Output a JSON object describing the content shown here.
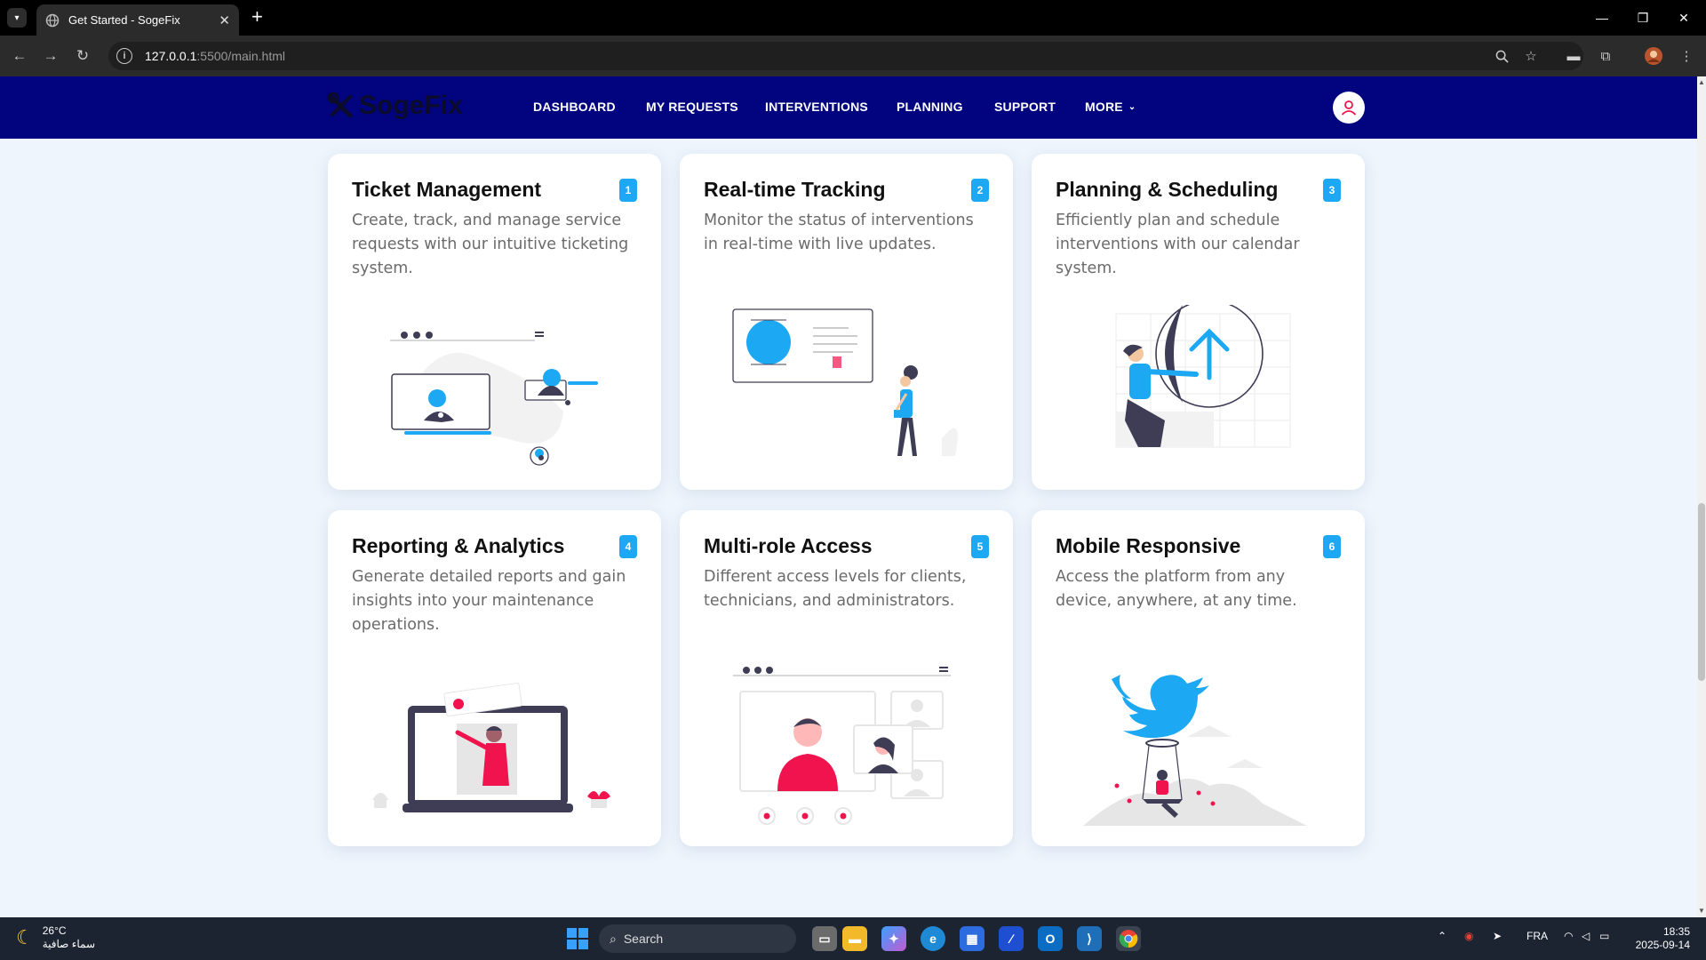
{
  "browser": {
    "tab_title": "Get Started - SogeFix",
    "url_host": "127.0.0.1",
    "url_rest": ":5500/main.html"
  },
  "app": {
    "logo_text": "SogeFix",
    "nav": [
      "DASHBOARD",
      "MY REQUESTS",
      "INTERVENTIONS",
      "PLANNING",
      "SUPPORT",
      "MORE"
    ],
    "accent": "#1ca8f3",
    "nav_bg": "#02037e",
    "pink": "#f0134d"
  },
  "features": [
    {
      "num": "1",
      "title": "Ticket Management",
      "desc": "Create, track, and manage service requests with our intuitive ticketing system.",
      "icon": "ticket-illustration"
    },
    {
      "num": "2",
      "title": "Real-time Tracking",
      "desc": "Monitor the status of interventions in real-time with live updates.",
      "icon": "tracking-illustration"
    },
    {
      "num": "3",
      "title": "Planning & Scheduling",
      "desc": "Efficiently plan and schedule interventions with our calendar system.",
      "icon": "planning-illustration"
    },
    {
      "num": "4",
      "title": "Reporting & Analytics",
      "desc": "Generate detailed reports and gain insights into your maintenance operations.",
      "icon": "reporting-illustration"
    },
    {
      "num": "5",
      "title": "Multi-role Access",
      "desc": "Different access levels for clients, technicians, and administrators.",
      "icon": "video-call-illustration"
    },
    {
      "num": "6",
      "title": "Mobile Responsive",
      "desc": "Access the platform from any device, anywhere, at any time.",
      "icon": "twitter-bird-illustration"
    }
  ],
  "taskbar": {
    "temp": "26°C",
    "weather_desc": "سماء صافية",
    "search_placeholder": "Search",
    "lang": "FRA",
    "time": "18:35",
    "date": "2025-09-14"
  }
}
